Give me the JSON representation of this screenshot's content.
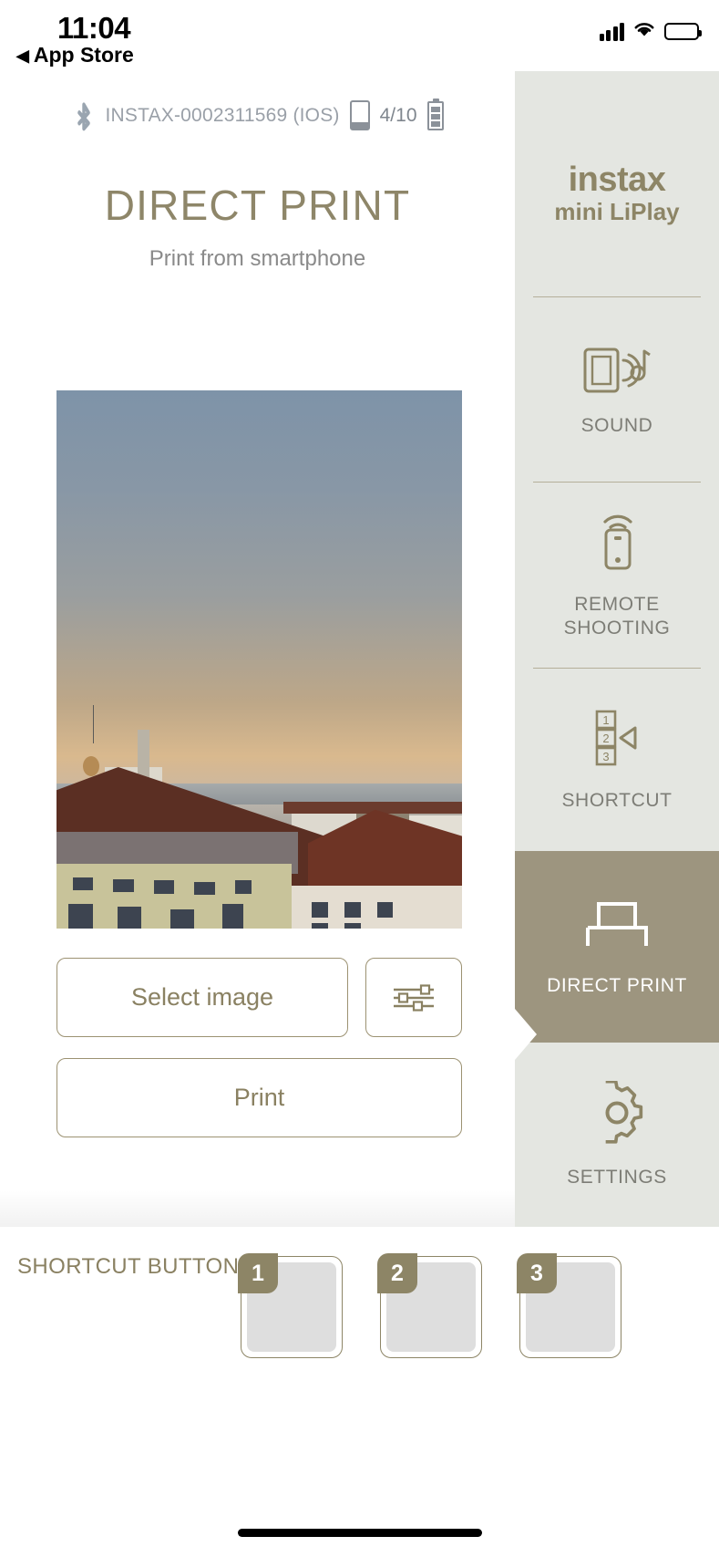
{
  "ios_status": {
    "time": "11:04",
    "back_label": "App Store",
    "back_caret": "◀",
    "signal_icon": "cellular-signal-icon",
    "wifi_icon": "wifi-icon",
    "battery_icon": "battery-icon"
  },
  "device_status": {
    "bluetooth_icon": "bluetooth-icon",
    "device_name": "INSTAX-0002311569 (IOS)",
    "film_icon": "film-cartridge-icon",
    "film_count": "4/10",
    "battery_icon": "printer-battery-icon"
  },
  "header": {
    "title": "DIRECT PRINT",
    "subtitle": "Print from smartphone"
  },
  "preview": {
    "alt": "rooftop cityscape at dusk"
  },
  "actions": {
    "select_image": "Select image",
    "adjust_icon": "sliders-adjust-icon",
    "print": "Print"
  },
  "sidebar": {
    "logo_line1": "instax",
    "logo_line2": "mini LiPlay",
    "items": [
      {
        "label": "SOUND",
        "icon": "sound-device-icon",
        "active": false
      },
      {
        "label": "REMOTE\nSHOOTING",
        "label_line1": "REMOTE",
        "label_line2": "SHOOTING",
        "icon": "remote-shutter-icon",
        "active": false
      },
      {
        "label": "SHORTCUT",
        "icon": "shortcut-list-icon",
        "active": false
      },
      {
        "label": "DIRECT PRINT",
        "icon": "printer-icon",
        "active": true
      },
      {
        "label": "SETTINGS",
        "icon": "gear-icon",
        "active": false
      }
    ]
  },
  "shortcut_bar": {
    "label": "SHORTCUT BUTTONS",
    "slots": [
      {
        "number": "1"
      },
      {
        "number": "2"
      },
      {
        "number": "3"
      }
    ]
  },
  "colors": {
    "accent_khaki": "#8d8566",
    "active_tile": "#9d957f",
    "sidebar_bg": "#e4e6e1",
    "muted_text": "#7d7d76",
    "device_text": "#9aa0a8"
  }
}
